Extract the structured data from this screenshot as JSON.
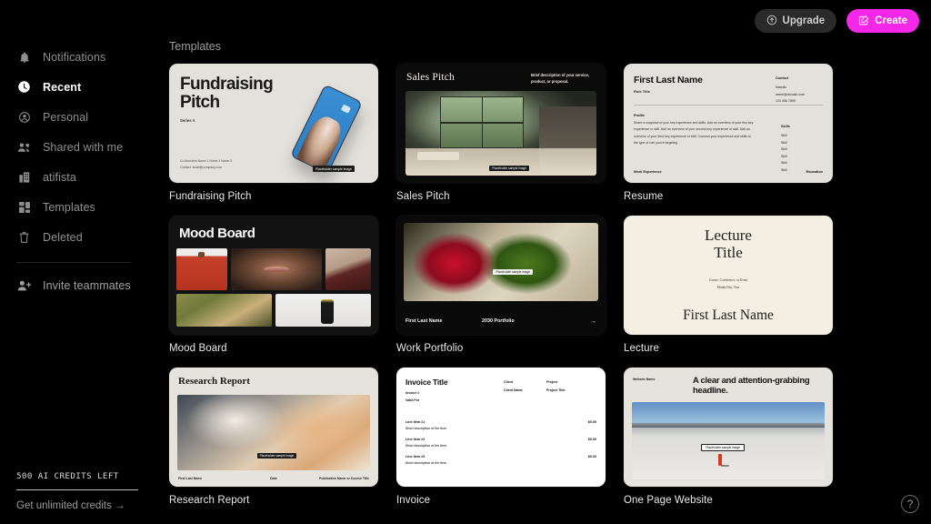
{
  "sidebar": {
    "items": [
      {
        "label": "Notifications",
        "icon": "bell-icon",
        "active": false
      },
      {
        "label": "Recent",
        "icon": "clock-icon",
        "active": true
      },
      {
        "label": "Personal",
        "icon": "user-circle-icon",
        "active": false
      },
      {
        "label": "Shared with me",
        "icon": "people-icon",
        "active": false
      },
      {
        "label": "atifista",
        "icon": "building-icon",
        "active": false
      },
      {
        "label": "Templates",
        "icon": "grid-icon",
        "active": false
      },
      {
        "label": "Deleted",
        "icon": "trash-icon",
        "active": false
      }
    ],
    "invite": {
      "label": "Invite teammates",
      "icon": "user-plus-icon"
    },
    "credits": {
      "text": "500 AI CREDITS LEFT",
      "link": "Get unlimited credits →"
    }
  },
  "topbar": {
    "upgrade_label": "Upgrade",
    "upgrade_icon": "arrow-up-circle-icon",
    "create_label": "Create",
    "create_icon": "pencil-square-icon",
    "create_color": "#f527e8"
  },
  "help_icon": "question-circle-icon",
  "main": {
    "section_title": "Templates",
    "cards": [
      {
        "caption": "Fundraising Pitch",
        "title": "Fundraising\nPitch",
        "subtitle": "Series A",
        "footer": "Co-founders Name 1 Name 2 Name 3\nContact: email@company.com",
        "image_caption": "Placeholder sample image"
      },
      {
        "caption": "Sales Pitch",
        "title": "Sales Pitch",
        "description": "Brief description of your service, product, or proposal.",
        "image_caption": "Placeholder sample image"
      },
      {
        "caption": "Resume",
        "name": "First Last Name",
        "role": "Role Title",
        "contact_heading": "Contact",
        "contact_lines": "linkedin\nname@domain.com\n123 456 7890",
        "profile_heading": "Profile",
        "profile_body": "Share a snapshot of your key experience and skills. Add an overview of your first key experience or skill. Add an overview of your second key experience or skill. Add an overview of your third key experience or skill. Connect your experience and skills to the type of role you're targeting.",
        "skills_heading": "Skills",
        "skills_items": "Skill\nSkill\nSkill\nSkill\nSkill\nSkill",
        "work_heading": "Work Experience",
        "education_heading": "Education"
      },
      {
        "caption": "Mood Board",
        "title": "Mood Board"
      },
      {
        "caption": "Work Portfolio",
        "name": "First Last Name",
        "subtitle": "2030 Portfolio",
        "arrow_icon": "arrow-right-icon",
        "image_caption": "Placeholder sample image"
      },
      {
        "caption": "Lecture",
        "title": "Lecture\nTitle",
        "meta": "Course, Conference, or Event\nMonth Day, Year",
        "name": "First Last Name"
      },
      {
        "caption": "Research Report",
        "title": "Research Report",
        "footer_left": "First Last Name",
        "footer_center": "Date",
        "footer_right": "Publication Name or Course Title",
        "image_caption": "Placeholder sample image"
      },
      {
        "caption": "Invoice",
        "title": "Invoice Title",
        "sub": "Invoice #\nValid For",
        "client_heading": "Client",
        "client_value": "Client Name",
        "project_heading": "Project",
        "project_value": "Project Title",
        "line_items": [
          {
            "name": "Line Item #1",
            "desc": "Short description of the item",
            "amount": "$0.00"
          },
          {
            "name": "Line Item #2",
            "desc": "Short description of the item",
            "amount": "$0.00"
          },
          {
            "name": "Line Item #3",
            "desc": "Short description of the item",
            "amount": "$0.00"
          }
        ]
      },
      {
        "caption": "One Page Website",
        "website_name": "Website Name",
        "headline": "A clear and attention-grabbing headline.",
        "image_caption": "Placeholder sample image"
      }
    ]
  }
}
